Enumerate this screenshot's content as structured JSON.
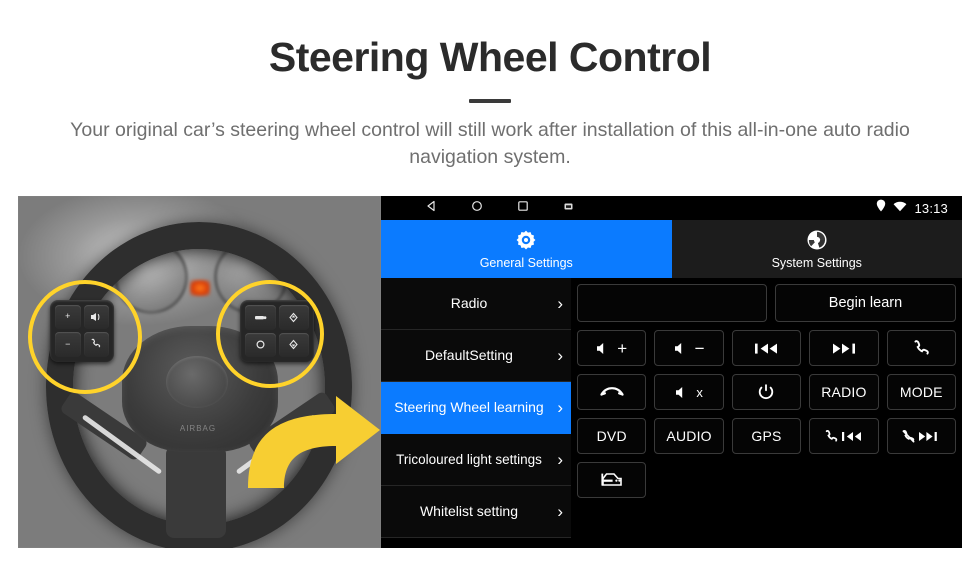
{
  "header": {
    "title": "Steering Wheel Control",
    "subtitle": "Your original car’s steering wheel control will still work after installation of this all-in-one auto radio navigation system."
  },
  "photo": {
    "alt_name": "steering-wheel-photo",
    "hub_text": "AIRBAG",
    "highlight_color": "#FFD32A",
    "arrow_color": "#F7CE32",
    "left_pad_keys": [
      "+",
      "−",
      "voice-assistant",
      "answer-call"
    ],
    "right_pad_keys": [
      "source",
      "up",
      "mode",
      "down"
    ]
  },
  "android": {
    "statusbar": {
      "nav_icons": [
        "back-icon",
        "home-icon",
        "recents-icon",
        "screenshot-icon"
      ],
      "status_icons": [
        "location-icon",
        "wifi-icon"
      ],
      "time": "13:13"
    },
    "tabs": [
      {
        "label": "General Settings",
        "icon": "gear-icon",
        "active": true
      },
      {
        "label": "System Settings",
        "icon": "aperture-icon",
        "active": false
      }
    ],
    "accent_color": "#0B7BFF",
    "menu": [
      {
        "label": "Radio",
        "active": false,
        "chevron": "›"
      },
      {
        "label": "DefaultSetting",
        "active": false,
        "chevron": "›"
      },
      {
        "label": "Steering Wheel learning",
        "active": true,
        "chevron": "›"
      },
      {
        "label": "Tricoloured light settings",
        "active": false,
        "chevron": "›"
      },
      {
        "label": "Whitelist setting",
        "active": false,
        "chevron": "›"
      }
    ],
    "panel": {
      "display_field_value": "",
      "begin_learn_label": "Begin learn",
      "buttons": [
        {
          "id": "vol-up",
          "label": "",
          "icon": "volume-up-icon"
        },
        {
          "id": "vol-down",
          "label": "",
          "icon": "volume-down-icon"
        },
        {
          "id": "prev-track",
          "label": "",
          "icon": "previous-track-icon"
        },
        {
          "id": "next-track",
          "label": "",
          "icon": "next-track-icon"
        },
        {
          "id": "answer-call",
          "label": "",
          "icon": "phone-icon"
        },
        {
          "id": "hang-up",
          "label": "",
          "icon": "hangup-icon"
        },
        {
          "id": "mute",
          "label": "",
          "icon": "volume-mute-icon"
        },
        {
          "id": "power",
          "label": "",
          "icon": "power-icon"
        },
        {
          "id": "radio",
          "label": "RADIO",
          "icon": ""
        },
        {
          "id": "mode",
          "label": "MODE",
          "icon": ""
        },
        {
          "id": "dvd",
          "label": "DVD",
          "icon": ""
        },
        {
          "id": "audio",
          "label": "AUDIO",
          "icon": ""
        },
        {
          "id": "gps",
          "label": "GPS",
          "icon": ""
        },
        {
          "id": "call-prev",
          "label": "",
          "icon": "phone-previous-icon"
        },
        {
          "id": "hangup-next",
          "label": "",
          "icon": "hangup-next-icon"
        },
        {
          "id": "car-info",
          "label": "",
          "icon": "car-icon"
        }
      ]
    }
  }
}
